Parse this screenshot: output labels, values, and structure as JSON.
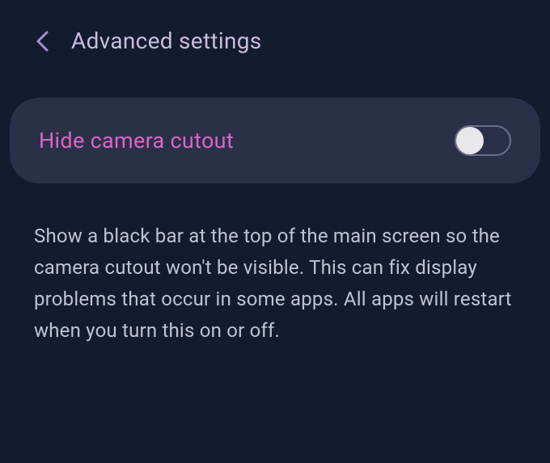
{
  "header": {
    "title": "Advanced settings"
  },
  "setting": {
    "label": "Hide camera cutout",
    "toggle_state": "off"
  },
  "description": "Show a black bar at the top of the main screen so the camera cutout won't be visible. This can fix display problems that occur in some apps. All apps will restart when you turn this on or off."
}
